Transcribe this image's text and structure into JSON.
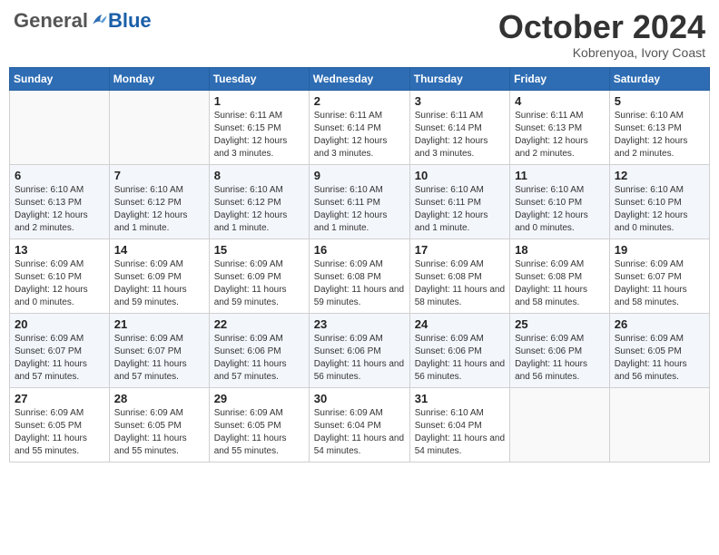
{
  "header": {
    "logo_general": "General",
    "logo_blue": "Blue",
    "month_title": "October 2024",
    "subtitle": "Kobrenyoa, Ivory Coast"
  },
  "days_of_week": [
    "Sunday",
    "Monday",
    "Tuesday",
    "Wednesday",
    "Thursday",
    "Friday",
    "Saturday"
  ],
  "weeks": [
    [
      {
        "day": "",
        "info": ""
      },
      {
        "day": "",
        "info": ""
      },
      {
        "day": "1",
        "info": "Sunrise: 6:11 AM\nSunset: 6:15 PM\nDaylight: 12 hours and 3 minutes."
      },
      {
        "day": "2",
        "info": "Sunrise: 6:11 AM\nSunset: 6:14 PM\nDaylight: 12 hours and 3 minutes."
      },
      {
        "day": "3",
        "info": "Sunrise: 6:11 AM\nSunset: 6:14 PM\nDaylight: 12 hours and 3 minutes."
      },
      {
        "day": "4",
        "info": "Sunrise: 6:11 AM\nSunset: 6:13 PM\nDaylight: 12 hours and 2 minutes."
      },
      {
        "day": "5",
        "info": "Sunrise: 6:10 AM\nSunset: 6:13 PM\nDaylight: 12 hours and 2 minutes."
      }
    ],
    [
      {
        "day": "6",
        "info": "Sunrise: 6:10 AM\nSunset: 6:13 PM\nDaylight: 12 hours and 2 minutes."
      },
      {
        "day": "7",
        "info": "Sunrise: 6:10 AM\nSunset: 6:12 PM\nDaylight: 12 hours and 1 minute."
      },
      {
        "day": "8",
        "info": "Sunrise: 6:10 AM\nSunset: 6:12 PM\nDaylight: 12 hours and 1 minute."
      },
      {
        "day": "9",
        "info": "Sunrise: 6:10 AM\nSunset: 6:11 PM\nDaylight: 12 hours and 1 minute."
      },
      {
        "day": "10",
        "info": "Sunrise: 6:10 AM\nSunset: 6:11 PM\nDaylight: 12 hours and 1 minute."
      },
      {
        "day": "11",
        "info": "Sunrise: 6:10 AM\nSunset: 6:10 PM\nDaylight: 12 hours and 0 minutes."
      },
      {
        "day": "12",
        "info": "Sunrise: 6:10 AM\nSunset: 6:10 PM\nDaylight: 12 hours and 0 minutes."
      }
    ],
    [
      {
        "day": "13",
        "info": "Sunrise: 6:09 AM\nSunset: 6:10 PM\nDaylight: 12 hours and 0 minutes."
      },
      {
        "day": "14",
        "info": "Sunrise: 6:09 AM\nSunset: 6:09 PM\nDaylight: 11 hours and 59 minutes."
      },
      {
        "day": "15",
        "info": "Sunrise: 6:09 AM\nSunset: 6:09 PM\nDaylight: 11 hours and 59 minutes."
      },
      {
        "day": "16",
        "info": "Sunrise: 6:09 AM\nSunset: 6:08 PM\nDaylight: 11 hours and 59 minutes."
      },
      {
        "day": "17",
        "info": "Sunrise: 6:09 AM\nSunset: 6:08 PM\nDaylight: 11 hours and 58 minutes."
      },
      {
        "day": "18",
        "info": "Sunrise: 6:09 AM\nSunset: 6:08 PM\nDaylight: 11 hours and 58 minutes."
      },
      {
        "day": "19",
        "info": "Sunrise: 6:09 AM\nSunset: 6:07 PM\nDaylight: 11 hours and 58 minutes."
      }
    ],
    [
      {
        "day": "20",
        "info": "Sunrise: 6:09 AM\nSunset: 6:07 PM\nDaylight: 11 hours and 57 minutes."
      },
      {
        "day": "21",
        "info": "Sunrise: 6:09 AM\nSunset: 6:07 PM\nDaylight: 11 hours and 57 minutes."
      },
      {
        "day": "22",
        "info": "Sunrise: 6:09 AM\nSunset: 6:06 PM\nDaylight: 11 hours and 57 minutes."
      },
      {
        "day": "23",
        "info": "Sunrise: 6:09 AM\nSunset: 6:06 PM\nDaylight: 11 hours and 56 minutes."
      },
      {
        "day": "24",
        "info": "Sunrise: 6:09 AM\nSunset: 6:06 PM\nDaylight: 11 hours and 56 minutes."
      },
      {
        "day": "25",
        "info": "Sunrise: 6:09 AM\nSunset: 6:06 PM\nDaylight: 11 hours and 56 minutes."
      },
      {
        "day": "26",
        "info": "Sunrise: 6:09 AM\nSunset: 6:05 PM\nDaylight: 11 hours and 56 minutes."
      }
    ],
    [
      {
        "day": "27",
        "info": "Sunrise: 6:09 AM\nSunset: 6:05 PM\nDaylight: 11 hours and 55 minutes."
      },
      {
        "day": "28",
        "info": "Sunrise: 6:09 AM\nSunset: 6:05 PM\nDaylight: 11 hours and 55 minutes."
      },
      {
        "day": "29",
        "info": "Sunrise: 6:09 AM\nSunset: 6:05 PM\nDaylight: 11 hours and 55 minutes."
      },
      {
        "day": "30",
        "info": "Sunrise: 6:09 AM\nSunset: 6:04 PM\nDaylight: 11 hours and 54 minutes."
      },
      {
        "day": "31",
        "info": "Sunrise: 6:10 AM\nSunset: 6:04 PM\nDaylight: 11 hours and 54 minutes."
      },
      {
        "day": "",
        "info": ""
      },
      {
        "day": "",
        "info": ""
      }
    ]
  ]
}
